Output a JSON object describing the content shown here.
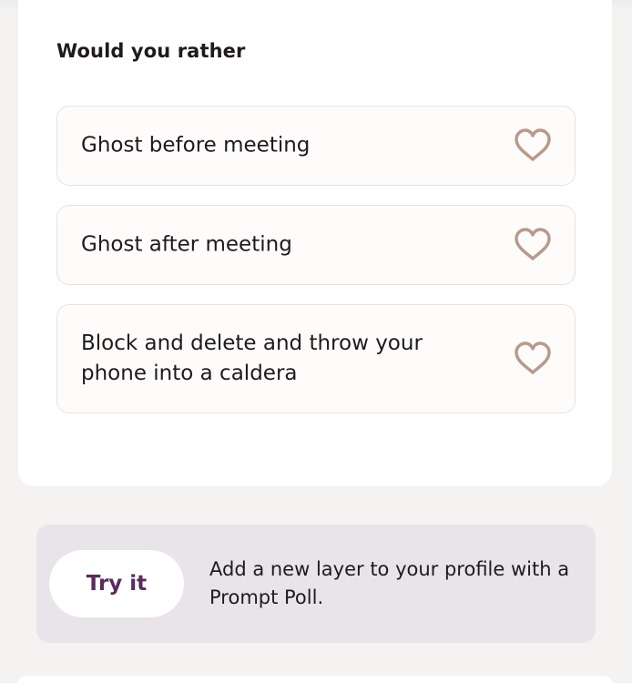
{
  "prompt": {
    "title": "Would you rather",
    "options": [
      {
        "label": "Ghost before meeting",
        "icon": "heart-outline-icon"
      },
      {
        "label": "Ghost after meeting",
        "icon": "heart-outline-icon"
      },
      {
        "label": "Block and delete and throw your phone into a caldera",
        "icon": "heart-outline-icon"
      }
    ]
  },
  "promo": {
    "button_label": "Try it",
    "text": "Add a new layer to your profile with a Prompt Poll."
  },
  "colors": {
    "background": "#f5f3f1",
    "card": "#ffffff",
    "option_border": "#e7e2de",
    "heart": "#b89a8c",
    "promo_background": "#e9e4e9",
    "button_text": "#5a2a5a"
  }
}
